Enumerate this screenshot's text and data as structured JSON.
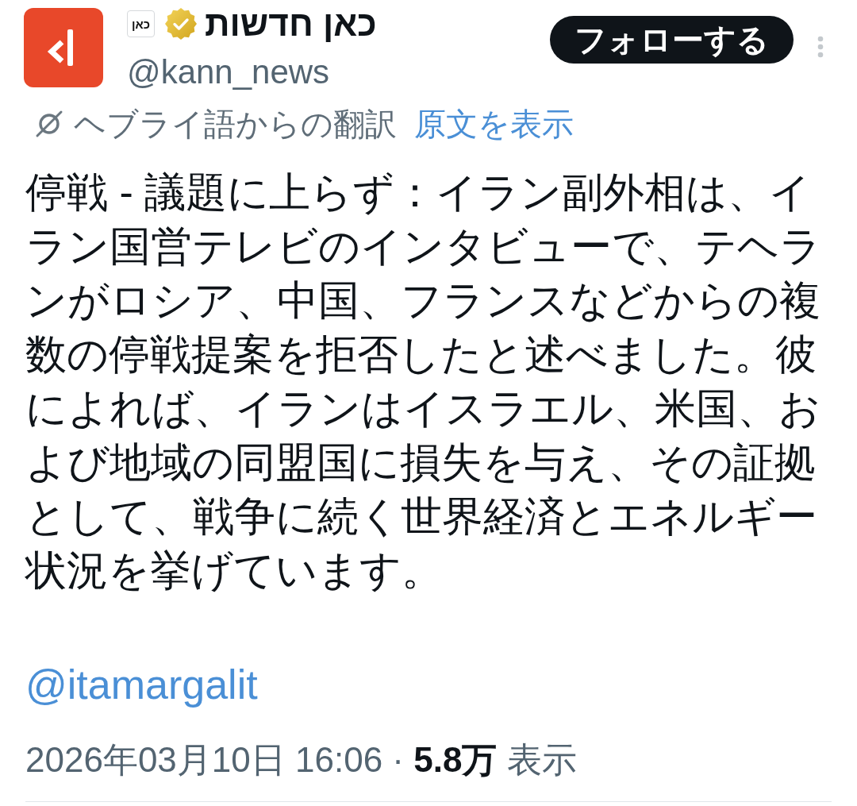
{
  "account": {
    "display_name": "כאן חדשות",
    "affiliate_badge": "כאן",
    "verified": true,
    "handle": "@kann_news"
  },
  "follow_button": {
    "label": "フォローする"
  },
  "translation": {
    "label": "ヘブライ語からの翻訳",
    "link": "原文を表示"
  },
  "post": {
    "text": "停戦 - 議題に上らず：イラン副外相は、イラン国営テレビのインタビューで、テヘランがロシア、中国、フランスなどからの複数の停戦提案を拒否したと述べました。彼によれば、イランはイスラエル、米国、および地域の同盟国に損失を与え、その証拠として、戦争に続く世界経済とエネルギー状況を挙げています。",
    "mention": "@itamargalit"
  },
  "meta": {
    "line": "2026年03月10日 16:06 · **5.8万** 表示"
  }
}
